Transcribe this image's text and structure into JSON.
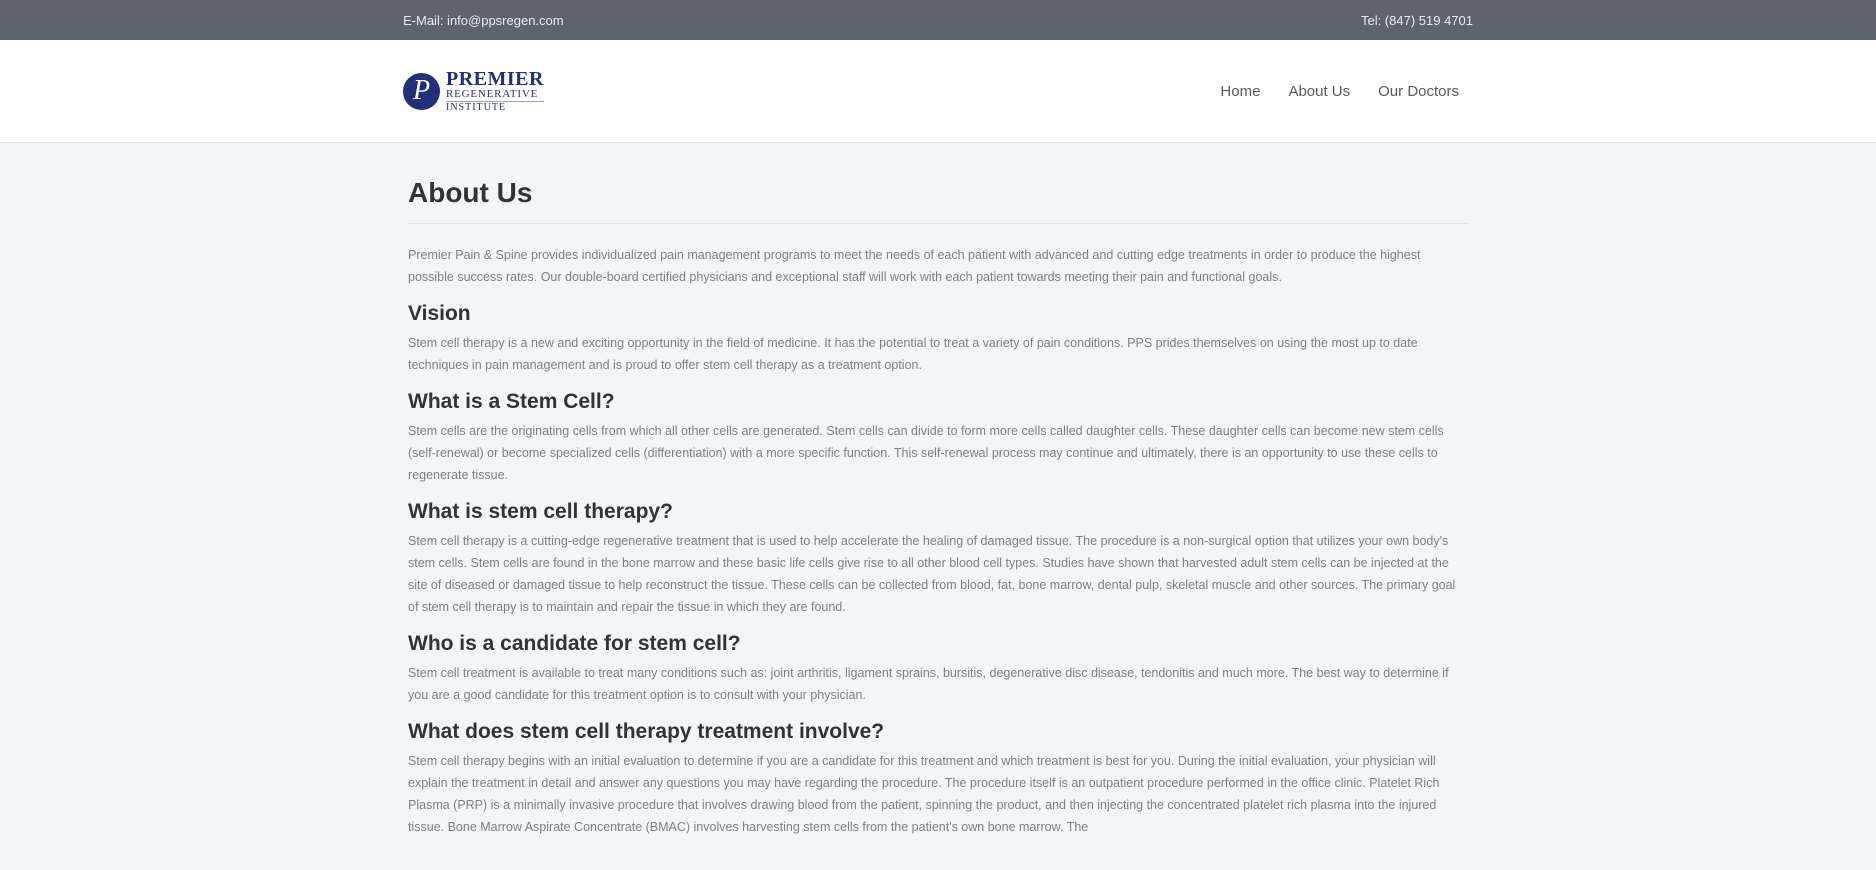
{
  "topbar": {
    "email": "E-Mail: info@ppsregen.com",
    "phone": "Tel: (847) 519 4701"
  },
  "logo": {
    "mark": "P",
    "line1": "PREMIER",
    "line2": "REGENERATIVE",
    "line3": "INSTITUTE"
  },
  "nav": [
    "Home",
    "About Us",
    "Our Doctors"
  ],
  "page_title": "About Us",
  "intro": "Premier Pain & Spine provides individualized pain management programs to meet the needs of each patient with advanced and cutting edge treatments in order to produce the highest possible success rates. Our double-board certified physicians and exceptional staff will work with each patient towards meeting their pain and functional goals.",
  "sections": [
    {
      "heading": "Vision",
      "text": "Stem cell therapy is a new and exciting opportunity in the field of medicine. It has the potential to treat a variety of pain conditions. PPS prides themselves on using the most up to date techniques in pain management and is proud to offer stem cell therapy as a treatment option."
    },
    {
      "heading": "What is a Stem Cell?",
      "text": "Stem cells are the originating cells from which all other cells are generated. Stem cells can divide to form more cells called daughter cells. These daughter cells can become new stem cells (self-renewal) or become specialized cells (differentiation) with a more specific function. This self-renewal process may continue and ultimately, there is an opportunity to use these cells to regenerate tissue."
    },
    {
      "heading": "What is stem cell therapy?",
      "text": "Stem cell therapy is a cutting-edge regenerative treatment that is used to help accelerate the healing of damaged tissue. The procedure is a non-surgical option that utilizes your own body's stem cells. Stem cells are found in the bone marrow and these basic life cells give rise to all other blood cell types. Studies have shown that harvested adult stem cells can be injected at the site of diseased or damaged tissue to help reconstruct the tissue. These cells can be collected from blood, fat, bone marrow, dental pulp, skeletal muscle and other sources. The primary goal of stem cell therapy is to maintain and repair the tissue in which they are found."
    },
    {
      "heading": "Who is a candidate for stem cell?",
      "text": "Stem cell treatment is available to treat many conditions such as: joint arthritis, ligament sprains, bursitis, degenerative disc disease, tendonitis and much more. The best way to determine if you are a good candidate for this treatment option is to consult with your physician."
    },
    {
      "heading": "What does stem cell therapy treatment involve?",
      "text": "Stem cell therapy begins with an initial evaluation to determine if you are a candidate for this treatment and which treatment is best for you. During the initial evaluation, your physician will explain the treatment in detail and answer any questions you may have regarding the procedure. The procedure itself is an outpatient procedure performed in the office clinic. Platelet Rich Plasma (PRP) is a minimally invasive procedure that involves drawing blood from the patient, spinning the product, and then injecting the concentrated platelet rich plasma into the injured tissue. Bone Marrow Aspirate Concentrate (BMAC) involves harvesting stem cells from the patient's own bone marrow. The"
    }
  ]
}
